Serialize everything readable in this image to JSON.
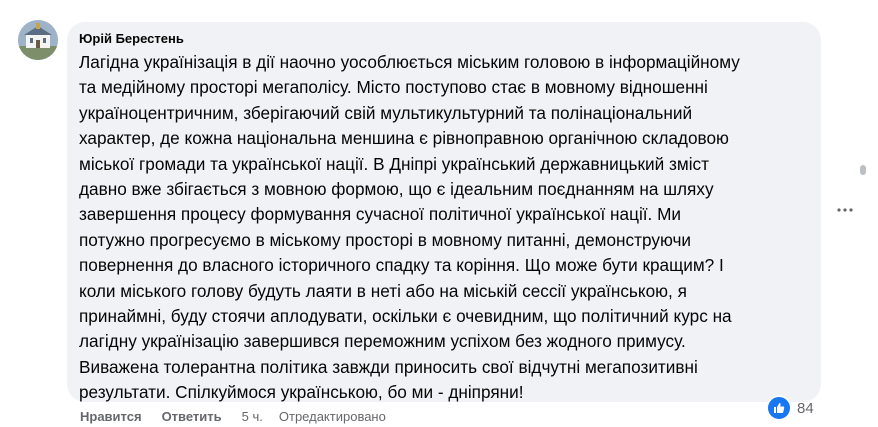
{
  "comment": {
    "author": "Юрій Берестень",
    "lines": [
      "Лагідна українізація в дії наочно уособлюється міським головою в інформаційному",
      "та медійному просторі мегаполісу. Місто поступово стає в мовному відношенні",
      "україноцентричним, зберігаючий свій мультикультурний та полінаціональний",
      "характер, де кожна національна меншина є рівноправною органічною складовою",
      "міської громади та української нації. В Дніпрі український державницький зміст",
      "давно вже збігається з мовною формою, що є ідеальним поєднанням на шляху",
      "завершення процесу формування сучасної політичної української нації. Ми",
      "потужно прогресуємо в міському просторі в мовному питанні, демонструючи",
      "повернення до власного історичного спадку та коріння. Що може бути кращим? І",
      "коли міського голову будуть лаяти в неті або на міській сессії українською, я",
      "принаймні, буду стоячи аплодувати, оскільки є очевидним, що політичний курс на",
      "лагідну українізацію завершився переможним успіхом без жодного примусу.",
      "Виважена толерантна політика завжди приносить свої відчутні мегапозитивні",
      "результати. Спілкуймося українською, бо ми - дніпряни!"
    ]
  },
  "actions": {
    "like": "Нравится",
    "reply": "Ответить",
    "time": "5 ч.",
    "edited": "Отредактировано"
  },
  "reactions": {
    "count": "84",
    "icon": "like-icon",
    "color": "#1877f2"
  },
  "menu": {
    "icon": "more-horizontal-icon"
  }
}
